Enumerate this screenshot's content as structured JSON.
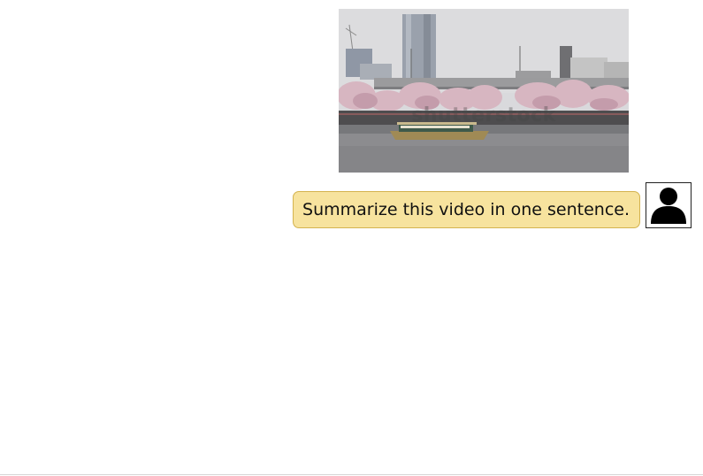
{
  "chat": {
    "attachment": {
      "type": "video-thumbnail",
      "watermark": "shutterstock"
    },
    "user_message": {
      "text": "Summarize this video in one sentence."
    },
    "avatar_icon": "user-silhouette-icon"
  },
  "colors": {
    "bubble_background": "#f7e39e",
    "bubble_border": "#d4b34f",
    "page_background": "#ffffff"
  }
}
